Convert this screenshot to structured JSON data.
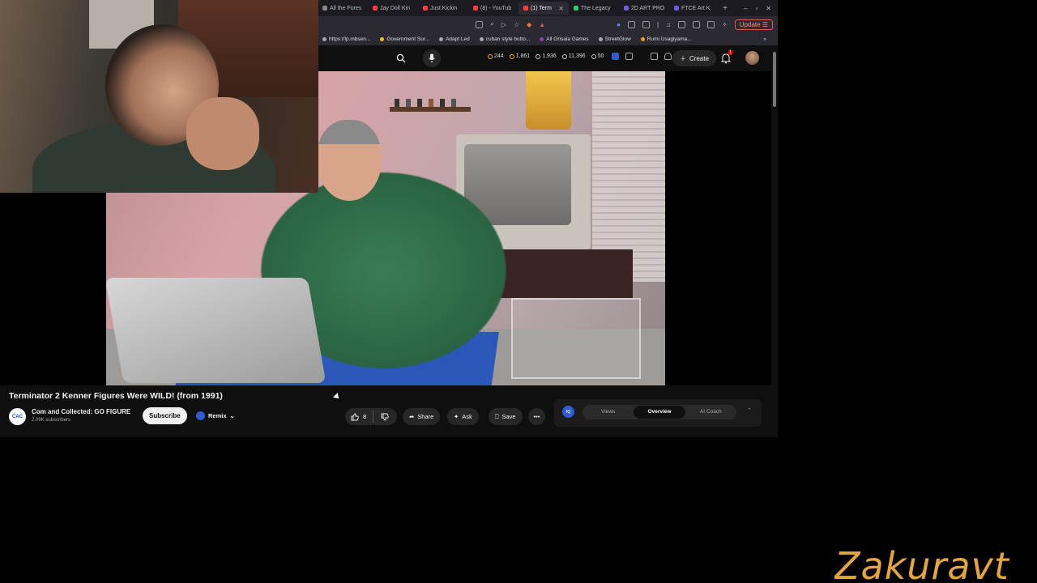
{
  "browser": {
    "tabs": [
      {
        "label": "All the Fores",
        "color": "#888888"
      },
      {
        "label": "Jay Doll Kin",
        "color": "#ff3b3b"
      },
      {
        "label": "Just Kickin",
        "color": "#ff3b3b"
      },
      {
        "label": "(8) - YouTub",
        "color": "#ff3b3b"
      },
      {
        "label": "(1) Term",
        "color": "#ff3b3b",
        "active": true
      },
      {
        "label": "The Legacy",
        "color": "#2ecc71"
      },
      {
        "label": "2D ART PRO",
        "color": "#6c5ce7"
      },
      {
        "label": "FTCE Art K",
        "color": "#6c5ce7"
      }
    ],
    "update_label": "Update",
    "bookmarks": [
      "https://lp.mbsen...",
      "Government Sur...",
      "Adapt Led",
      "cuban style butto...",
      "All Grisaia Games",
      "StreetGlow",
      "Rumi Usagiyama..."
    ],
    "bookmarks_more": "»"
  },
  "header": {
    "stats": [
      "244",
      "1,861",
      "1,936",
      "11,396",
      "50"
    ],
    "create_label": "Create",
    "notification_count": "1"
  },
  "video": {
    "title": "Terminator 2 Kenner Figures Were WILD! (from 1991)",
    "channel_logo_text": "CAC",
    "channel_name": "Com and Collected: GO FIGURE",
    "subscribers": "2.09K subscribers",
    "subscribe_label": "Subscribe",
    "remix_label": "Remix",
    "like_count": "8",
    "share_label": "Share",
    "ask_label": "Ask",
    "save_label": "Save"
  },
  "side_panel": {
    "logo_text": "IQ",
    "tabs": [
      "Views",
      "Overview",
      "AI Coach"
    ],
    "active_tab": "Overview"
  },
  "watermark": "Zakuravt"
}
